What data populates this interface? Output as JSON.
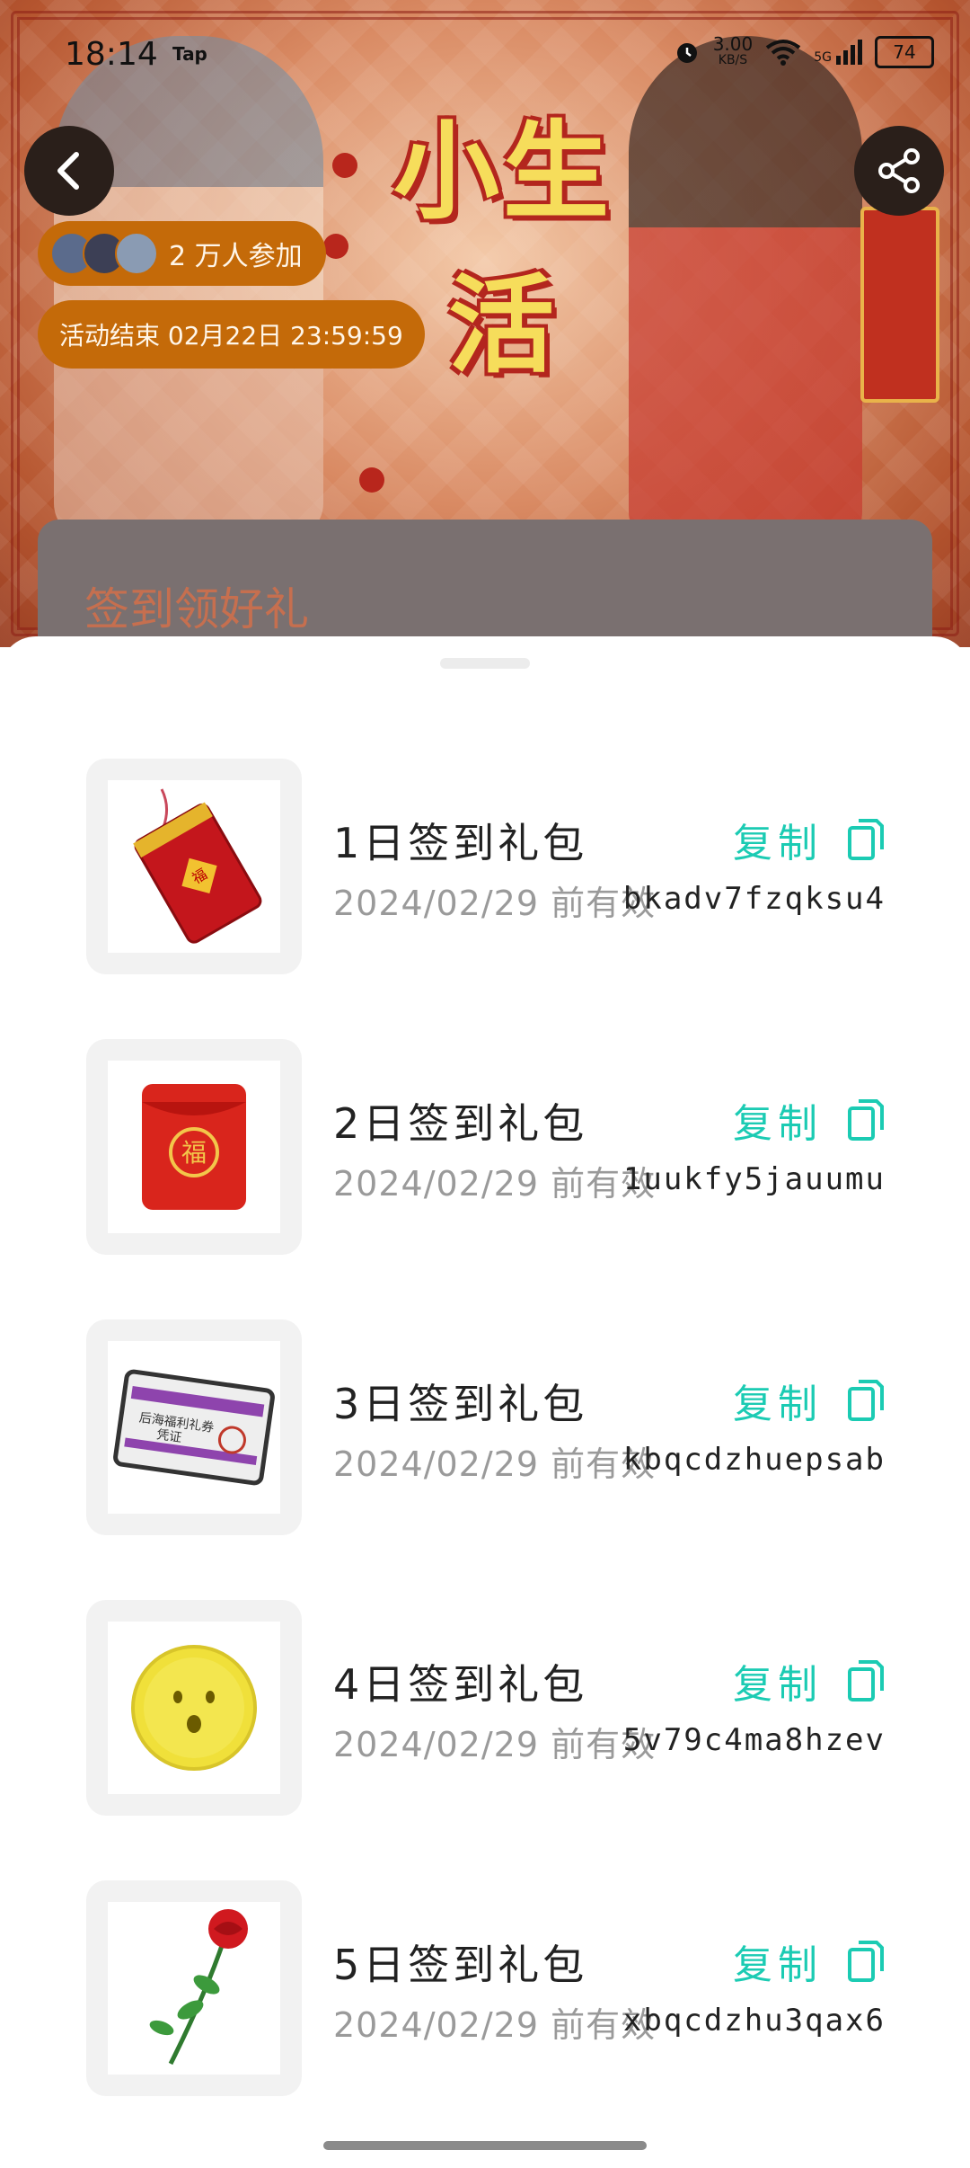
{
  "status": {
    "time": "18:14",
    "app_label": "Tap",
    "net_speed_value": "3.00",
    "net_speed_unit": "KB/S",
    "network": "5G",
    "battery": "74"
  },
  "header": {
    "title": "小生活",
    "participants": "2 万人参加",
    "deadline": "活动结束 02月22日 23:59:59",
    "section_title": "签到领好礼"
  },
  "icons": {
    "back": "back-chevron-icon",
    "share": "share-icon",
    "copy": "copy-icon",
    "alarm": "alarm-icon",
    "wifi": "wifi-icon",
    "signal": "signal-icon",
    "battery": "battery-icon"
  },
  "colors": {
    "accent": "#1bcbb3",
    "pill": "#c46a09",
    "banner_title": "#f6dd5b"
  },
  "gifts": [
    {
      "name": "1日签到礼包",
      "valid": "2024/02/29 前有效",
      "copy_label": "复制",
      "code": "bkadv7fzqksu4",
      "image": "red-envelope-tag"
    },
    {
      "name": "2日签到礼包",
      "valid": "2024/02/29 前有效",
      "copy_label": "复制",
      "code": "1uukfy5jauumu",
      "image": "red-envelope-fu"
    },
    {
      "name": "3日签到礼包",
      "valid": "2024/02/29 前有效",
      "copy_label": "复制",
      "code": "kbqcdzhuepsab",
      "image": "voucher-card"
    },
    {
      "name": "4日签到礼包",
      "valid": "2024/02/29 前有效",
      "copy_label": "复制",
      "code": "5v79c4ma8hzev",
      "image": "gold-coin"
    },
    {
      "name": "5日签到礼包",
      "valid": "2024/02/29 前有效",
      "copy_label": "复制",
      "code": "xbqcdzhu3qax6",
      "image": "red-rose"
    }
  ],
  "voucher_text": {
    "line1": "后海福利礼券",
    "line2": "凭证"
  }
}
